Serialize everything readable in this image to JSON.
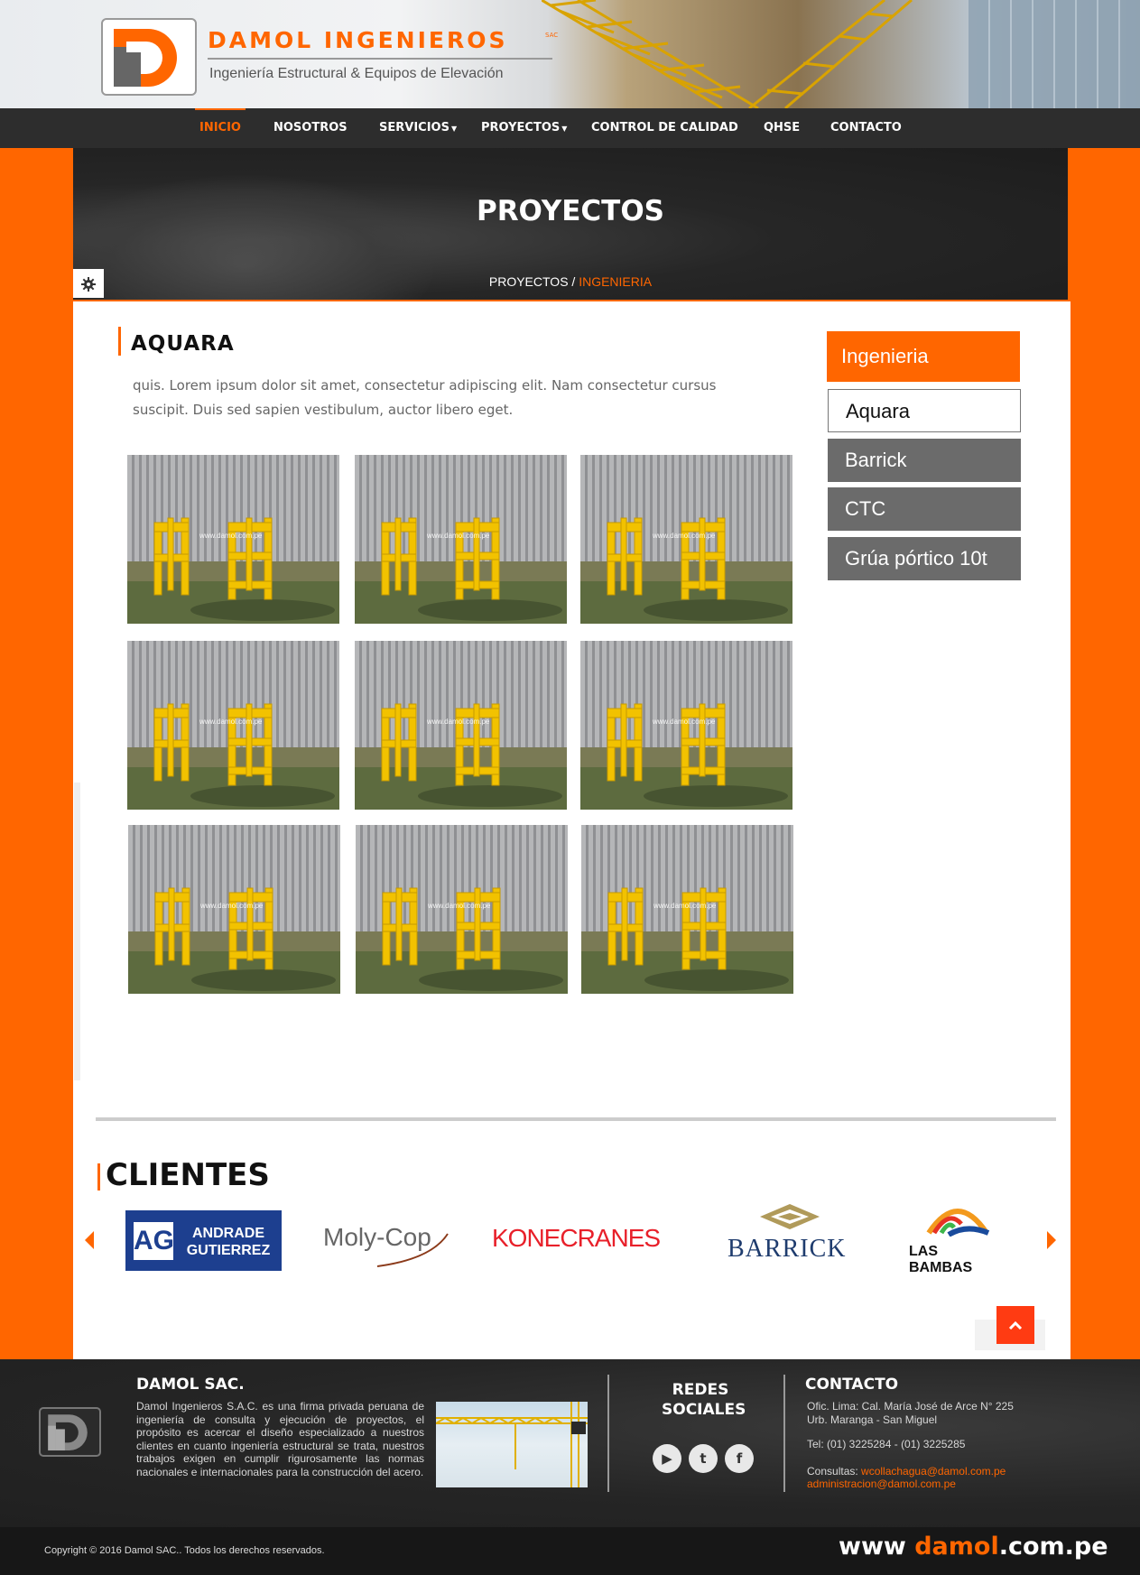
{
  "brand": {
    "name": "DAMOL INGENIEROS",
    "sac": "SAC",
    "tagline": "Ingeniería Estructural & Equipos de Elevación"
  },
  "nav": {
    "items": [
      {
        "label": "INICIO",
        "active": true
      },
      {
        "label": "NOSOTROS"
      },
      {
        "label": "SERVICIOS",
        "dropdown": true
      },
      {
        "label": "PROYECTOS",
        "dropdown": true
      },
      {
        "label": "CONTROL DE CALIDAD"
      },
      {
        "label": "QHSE"
      },
      {
        "label": "CONTACTO"
      }
    ]
  },
  "banner": {
    "title": "PROYECTOS",
    "breadcrumb_root": "PROYECTOS",
    "breadcrumb_sep": " / ",
    "breadcrumb_current": "INGENIERIA"
  },
  "project": {
    "title": "AQUARA",
    "description": "quis. Lorem ipsum dolor sit amet, consectetur adipiscing elit. Nam consectetur cursus suscipit. Duis sed sapien vestibulum, auctor libero eget.",
    "gallery_watermark": "www.damol.com.pe"
  },
  "sidebar": {
    "heading": "Ingenieria",
    "items": [
      {
        "label": "Aquara",
        "active": true
      },
      {
        "label": "Barrick"
      },
      {
        "label": "CTC"
      },
      {
        "label": "Grúa pórtico 10t"
      }
    ]
  },
  "clients": {
    "title": "CLIENTES",
    "logos": [
      {
        "name": "ANDRADE GUTIERREZ",
        "short": "AG",
        "line1": "ANDRADE",
        "line2": "GUTIERREZ",
        "color": "#1d3f8f"
      },
      {
        "name": "Moly-Cop",
        "color": "#666666"
      },
      {
        "name": "KONECRANES",
        "color": "#e8202a"
      },
      {
        "name": "BARRICK",
        "color": "#1f3c6e"
      },
      {
        "name": "LAS BAMBAS",
        "color": "#111111"
      }
    ]
  },
  "footer": {
    "about_title": "DAMOL SAC.",
    "about_text": "Damol Ingenieros S.A.C. es una firma privada peruana de ingeniería de consulta y ejecución de proyectos, el propósito es acercar el diseño especializado a nuestros clientes en cuanto ingeniería estructural se trata, nuestros trabajos exigen en cumplir rigurosamente las normas nacionales e internacionales para la construcción del acero.",
    "social_title_1": "REDES",
    "social_title_2": "SOCIALES",
    "social": [
      {
        "icon": "youtube-icon",
        "glyph": "▶"
      },
      {
        "icon": "twitter-icon",
        "glyph": "t"
      },
      {
        "icon": "facebook-icon",
        "glyph": "f"
      }
    ],
    "contact_title": "CONTACTO",
    "address_1": "Ofic. Lima: Cal. María José de Arce N° 225",
    "address_2": "Urb. Maranga - San Miguel",
    "phone": "Tel: (01) 3225284 - (01) 3225285",
    "consult_label": "Consultas: ",
    "email_1": "wcollachagua@damol.com.pe",
    "email_2": "administracion@damol.com.pe",
    "copyright": "Copyright © 2016 Damol SAC.. Todos los derechos reservados.",
    "url_prefix": "www ",
    "url_brand": "damol",
    "url_suffix": ".com.pe"
  },
  "colors": {
    "accent": "#ff6600",
    "nav_bg": "#2d2d2d",
    "side_item": "#6b6b6b"
  }
}
